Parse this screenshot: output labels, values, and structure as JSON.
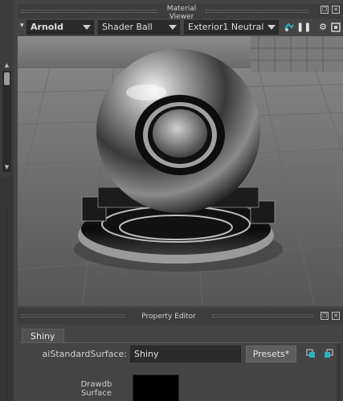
{
  "material_viewer": {
    "title": "Material Viewer",
    "renderer": "Arnold",
    "geometry": "Shader Ball",
    "environment": "Exterior1 Neutral",
    "window_buttons": [
      "restore-icon",
      "close-icon"
    ]
  },
  "property_editor": {
    "title": "Property Editor",
    "tab_label": "Shiny",
    "shader_label": "aiStandardSurface:",
    "shader_name": "Shiny",
    "presets_label": "Presets*",
    "swatch_label": "Drawdb Surface"
  },
  "colors": {
    "panel_bg": "#444444",
    "field_bg": "#2b2b2b",
    "accent_teal": "#2bb3c0"
  }
}
